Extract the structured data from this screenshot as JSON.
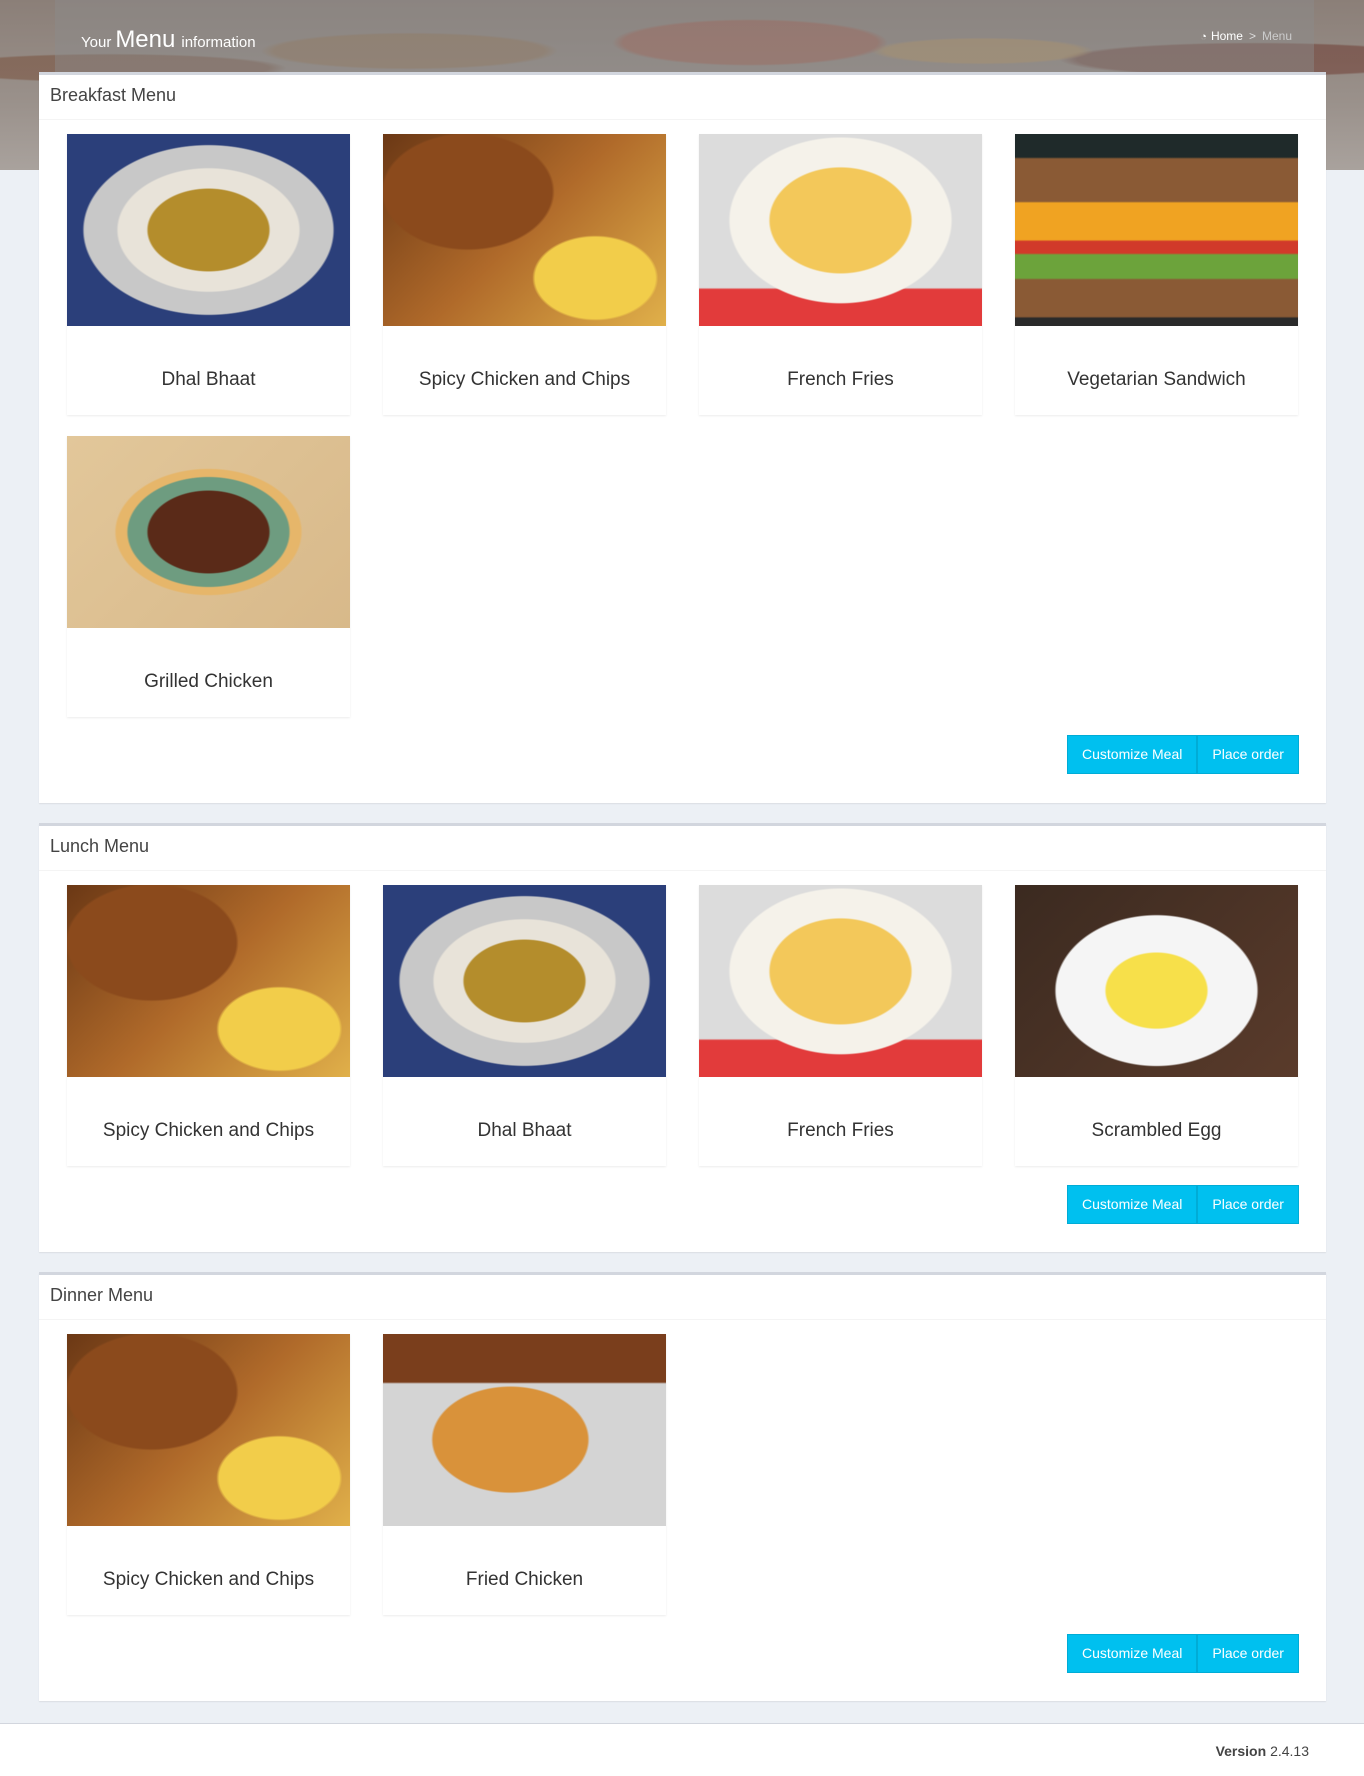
{
  "header": {
    "brand_prefix": "Your",
    "brand_main": "Menu",
    "brand_suffix": "information",
    "breadcrumb": {
      "home": "Home",
      "separator": ">",
      "current": "Menu"
    }
  },
  "sections": [
    {
      "title": "Breakfast Menu",
      "items": [
        {
          "label": "Dhal Bhaat",
          "image": "dhal-bhaat-photo"
        },
        {
          "label": "Spicy Chicken and Chips",
          "image": "spicy-chicken-chips-photo"
        },
        {
          "label": "French Fries",
          "image": "french-fries-photo"
        },
        {
          "label": "Vegetarian Sandwich",
          "image": "vegetarian-sandwich-photo"
        },
        {
          "label": "Grilled Chicken",
          "image": "grilled-chicken-photo"
        }
      ],
      "buttons": {
        "customize": "Customize Meal",
        "order": "Place order"
      }
    },
    {
      "title": "Lunch Menu",
      "items": [
        {
          "label": "Spicy Chicken and Chips",
          "image": "spicy-chicken-chips-photo"
        },
        {
          "label": "Dhal Bhaat",
          "image": "dhal-bhaat-photo"
        },
        {
          "label": "French Fries",
          "image": "french-fries-photo"
        },
        {
          "label": "Scrambled Egg",
          "image": "scrambled-egg-photo"
        }
      ],
      "buttons": {
        "customize": "Customize Meal",
        "order": "Place order"
      }
    },
    {
      "title": "Dinner Menu",
      "items": [
        {
          "label": "Spicy Chicken and Chips",
          "image": "spicy-chicken-chips-photo"
        },
        {
          "label": "Fried Chicken",
          "image": "fried-chicken-photo"
        }
      ],
      "buttons": {
        "customize": "Customize Meal",
        "order": "Place order"
      }
    }
  ],
  "footer": {
    "version_label": "Version",
    "version_number": "2.4.13"
  },
  "colors": {
    "accent": "#00c0ef",
    "background": "#ecf0f5",
    "box_border": "#d2d6de"
  }
}
